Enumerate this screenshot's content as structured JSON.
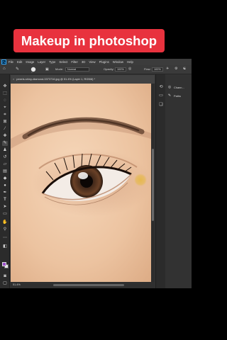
{
  "overlay": {
    "title": "Makeup in photoshop"
  },
  "menubar": {
    "logo": "Ps",
    "items": [
      "File",
      "Edit",
      "Image",
      "Layer",
      "Type",
      "Select",
      "Filter",
      "3D",
      "View",
      "Plugins",
      "Window",
      "Help"
    ]
  },
  "options_bar": {
    "mode_label": "Mode:",
    "mode_value": "Normal",
    "opacity_label": "Opacity:",
    "opacity_value": "100%",
    "flow_label": "Flow:",
    "flow_value": "100%"
  },
  "document": {
    "tab_title": "pexels-shiny-diamond-3373716.jpg @ 51.4% (Layer 1, RGB/8) *",
    "zoom": "51.4%"
  },
  "panels": {
    "items": [
      {
        "icon": "channels-icon",
        "label": "Chann..."
      },
      {
        "icon": "paths-icon",
        "label": "Paths"
      }
    ]
  },
  "colors": {
    "banner": "#e8323e",
    "foreground_swatch": "#9b4fc9",
    "background_swatch": "#e8e8e8",
    "brush_cursor": "#e6b84a"
  }
}
